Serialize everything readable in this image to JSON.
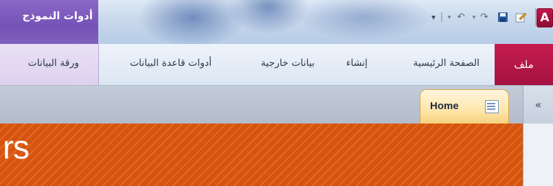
{
  "title_bar": {
    "app_logo": "A",
    "context_group_title": "أدوات النموذج"
  },
  "quick_access": {
    "customize_glyph": "▾",
    "separator": "|",
    "undo_glyph": "↶",
    "redo_glyph": "↷",
    "dropdown_glyph": "▾"
  },
  "ribbon_tabs": {
    "file": "ملف",
    "home": "الصفحة الرئيسية",
    "create": "إنشاء",
    "external_data": "بيانات خارجية",
    "database_tools": "أدوات قاعدة البيانات",
    "datasheet": "ورقة البيانات"
  },
  "document_tabs": {
    "home_label": "Home",
    "collapse_glyph": "«"
  },
  "form": {
    "header_text": "rs"
  },
  "colors": {
    "accent_file_tab": "#b3154a",
    "context_purple": "#7552b7",
    "form_header_orange": "#d5540f",
    "active_doc_tab": "#fde6ab"
  }
}
